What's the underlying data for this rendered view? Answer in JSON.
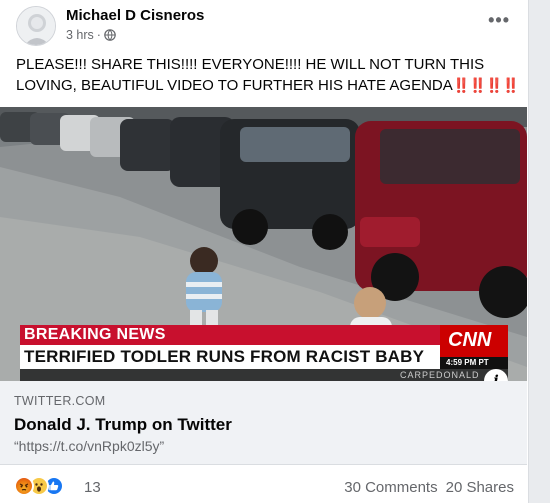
{
  "post": {
    "author": "Michael D Cisneros",
    "time": "3 hrs",
    "separator": "·",
    "more": "•••",
    "text": "PLEASE!!!  SHARE THIS!!!!  EVERYONE!!!!  HE WILL NOT TURN THIS LOVING, BEAUTIFUL VIDEO TO FURTHER HIS HATE AGENDA",
    "emphasis": "‼️‼️‼️‼️"
  },
  "video": {
    "banner_top": "BREAKING NEWS",
    "banner_main": "TERRIFIED TODLER RUNS FROM RACIST BABY",
    "network": "CNN",
    "time": "4:59 PM PT",
    "ticker": "CARPEDONALD",
    "info_icon": "info-icon"
  },
  "link": {
    "domain": "TWITTER.COM",
    "title": "Donald J. Trump on Twitter",
    "description": "“https://t.co/vnRpk0zl5y”"
  },
  "footer": {
    "reactions": [
      "angry",
      "wow",
      "like"
    ],
    "reaction_count": "13",
    "comments": "30 Comments",
    "shares": "20 Shares"
  },
  "colors": {
    "breaking_red": "#c8102e",
    "cnn_red": "#cc0000",
    "link_bg": "#f0f2f5",
    "muted": "#65676b"
  }
}
